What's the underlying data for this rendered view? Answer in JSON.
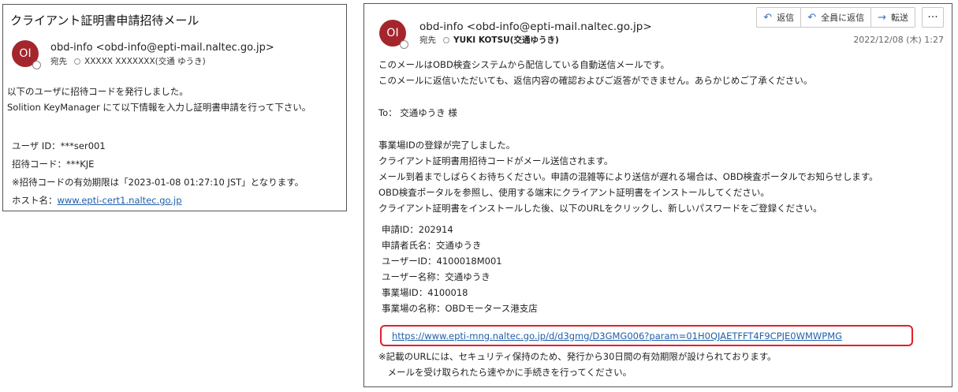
{
  "left": {
    "subject": "クライアント証明書申請招待メール",
    "avatar_initials": "OI",
    "sender": "obd-info <obd-info@epti-mail.naltec.go.jp>",
    "to_label": "宛先",
    "to_value": "XXXXX XXXXXXX(交通 ゆうき)",
    "body": [
      "以下のユーザに招待コードを発行しました。",
      "Solition KeyManager にて以下情報を入力し証明書申請を行って下さい。"
    ],
    "details": [
      "ユーザ ID：***ser001",
      "招待コード：***KJE",
      "※招待コードの有効期限は「2023-01-08 01:27:10 JST」となります。"
    ],
    "host_label": "ホスト名：",
    "host_link": "www.epti-cert1.naltec.go.jp"
  },
  "right": {
    "avatar_initials": "OI",
    "sender": "obd-info <obd-info@epti-mail.naltec.go.jp>",
    "to_label": "宛先",
    "to_value": "YUKI KOTSU(交通ゆうき)",
    "toolbar": {
      "reply_label": "返信",
      "reply_all_label": "全員に返信",
      "forward_label": "転送",
      "more_label": "···"
    },
    "date": "2022/12/08 (木) 1:27",
    "intro": [
      "このメールはOBD検査システムから配信している自動送信メールです。",
      "このメールに返信いただいても、返信内容の確認およびご返答ができません。あらかじめご了承ください。"
    ],
    "greeting": "To： 交通ゆうき 様",
    "body": [
      "事業場IDの登録が完了しました。",
      "クライアント証明書用招待コードがメール送信されます。",
      "メール到着までしばらくお待ちください。申請の混雑等により送信が遅れる場合は、OBD検査ポータルでお知らせします。",
      "OBD検査ポータルを参照し、使用する端末にクライアント証明書をインストールしてください。",
      "クライアント証明書をインストールした後、以下のURLをクリックし、新しいパスワードをご登録ください。"
    ],
    "details": [
      "申請ID：202914",
      "申請者氏名：交通ゆうき",
      "ユーザーID：4100018M001",
      "ユーザー名称：交通ゆうき",
      "事業場ID：4100018",
      "事業場の名称：OBDモータース港支店"
    ],
    "url": "https://www.epti-mng.naltec.go.jp/d/d3gmg/D3GMG006?param=01H0QJAETFFT4F9CPJE0WMWPMG",
    "note": [
      "※記載のURLには、セキュリティ保持のため、発行から30日間の有効期限が設けられております。",
      "　メールを受け取られたら速やかに手続きを行ってください。"
    ]
  }
}
